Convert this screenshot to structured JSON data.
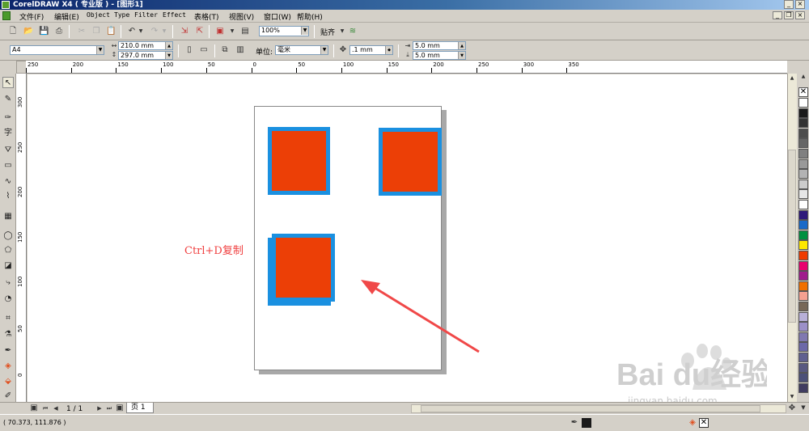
{
  "window": {
    "title": "CorelDRAW X4 ( 专业版 ) - [图形1]"
  },
  "menu": [
    "文件(F)",
    "编辑(E)",
    "Object",
    "Type",
    "Filter",
    "Effect",
    "表格(T)",
    "视图(V)",
    "窗口(W)",
    "帮助(H)"
  ],
  "toolbar": {
    "zoom_value": "100%",
    "snap_label": "贴齐"
  },
  "propertybar": {
    "paper_size": "A4",
    "width": "210.0 mm",
    "height": "297.0 mm",
    "unit_label": "单位:",
    "unit_value": "毫米",
    "nudge": ".1 mm",
    "dup_x": "5.0 mm",
    "dup_y": "5.0 mm"
  },
  "ruler": {
    "h_ticks": [
      "250",
      "200",
      "150",
      "100",
      "50",
      "0",
      "50",
      "100",
      "150",
      "200",
      "250",
      "300",
      "350"
    ],
    "v_ticks": [
      "300",
      "250",
      "200",
      "150",
      "100",
      "50",
      "0"
    ]
  },
  "annotation": {
    "text": "Ctrl+D复制"
  },
  "watermark": {
    "logo": "Baidu经验",
    "url": "jingyan.baidu.com"
  },
  "pagenav": {
    "position": "1 / 1",
    "page_tab": "页 1"
  },
  "status": {
    "coords": "( 70.373, 111.876 )"
  },
  "colors": {
    "fill": "#ec3f06",
    "outline": "#1a90e0",
    "arrow": "#f04848"
  },
  "palette": [
    "#ffffff",
    "#1a1a1a",
    "#333333",
    "#4d4d4d",
    "#666666",
    "#808080",
    "#999999",
    "#b3b3b3",
    "#cccccc",
    "#e6e6e6",
    "#ffffff",
    "#2e1a7a",
    "#1a6ac8",
    "#009040",
    "#ffe800",
    "#f03c00",
    "#e8006e",
    "#a01c8c",
    "#f07000",
    "#f4a090",
    "#786858",
    "#b8b0d8",
    "#9c90c8",
    "#8078b0",
    "#6c68a8",
    "#606090",
    "#585880",
    "#4c5078",
    "#403c60"
  ]
}
